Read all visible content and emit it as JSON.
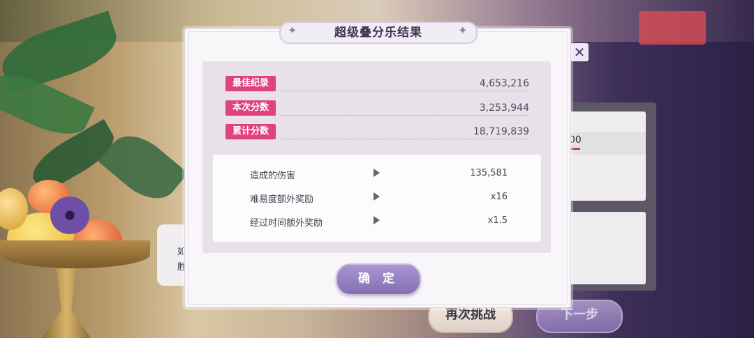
{
  "modal": {
    "title": "超级叠分乐结果",
    "scores": [
      {
        "label": "最佳纪录",
        "value": "4,653,216"
      },
      {
        "label": "本次分数",
        "value": "3,253,944"
      },
      {
        "label": "累计分数",
        "value": "18,719,839"
      }
    ],
    "details": [
      {
        "label": "造成的伤害",
        "value": "135,581"
      },
      {
        "label": "难易度额外奖励",
        "value": "x16"
      },
      {
        "label": "经过时间额外奖励",
        "value": "x1.5"
      }
    ],
    "confirm_label": "确 定"
  },
  "background": {
    "retry_label": "再次挑战",
    "next_label": "下一步",
    "side_text_1": "如",
    "side_text_2": "胜",
    "right_value": "00",
    "close_glyph": "✕"
  },
  "colors": {
    "accent_pink": "#e0427a",
    "button_purple": "#8a75b5"
  }
}
